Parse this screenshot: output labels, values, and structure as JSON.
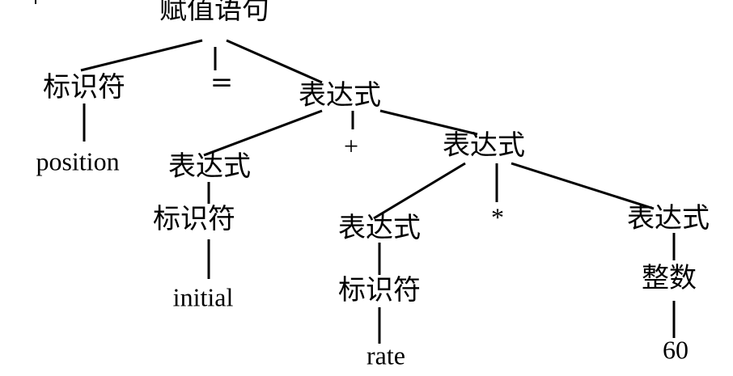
{
  "tree": {
    "nodes": [
      {
        "id": "root",
        "label": "赋值语句"
      },
      {
        "id": "id1",
        "label": "标识符"
      },
      {
        "id": "eq",
        "label": "="
      },
      {
        "id": "expr1",
        "label": "表达式"
      },
      {
        "id": "position",
        "label": "position"
      },
      {
        "id": "expr2",
        "label": "表达式"
      },
      {
        "id": "plus",
        "label": "+"
      },
      {
        "id": "expr3",
        "label": "表达式"
      },
      {
        "id": "id2",
        "label": "标识符"
      },
      {
        "id": "initial",
        "label": "initial"
      },
      {
        "id": "expr4",
        "label": "表达式"
      },
      {
        "id": "star",
        "label": "*"
      },
      {
        "id": "expr5",
        "label": "表达式"
      },
      {
        "id": "id3",
        "label": "标识符"
      },
      {
        "id": "rate",
        "label": "rate"
      },
      {
        "id": "int1",
        "label": "整数"
      },
      {
        "id": "num60",
        "label": "60"
      }
    ],
    "edges": [
      [
        "root",
        "id1"
      ],
      [
        "root",
        "eq"
      ],
      [
        "root",
        "expr1"
      ],
      [
        "id1",
        "position"
      ],
      [
        "expr1",
        "expr2"
      ],
      [
        "expr1",
        "plus"
      ],
      [
        "expr1",
        "expr3"
      ],
      [
        "expr2",
        "id2"
      ],
      [
        "id2",
        "initial"
      ],
      [
        "expr3",
        "expr4"
      ],
      [
        "expr3",
        "star"
      ],
      [
        "expr3",
        "expr5"
      ],
      [
        "expr4",
        "id3"
      ],
      [
        "id3",
        "rate"
      ],
      [
        "expr5",
        "int1"
      ],
      [
        "int1",
        "num60"
      ]
    ]
  }
}
